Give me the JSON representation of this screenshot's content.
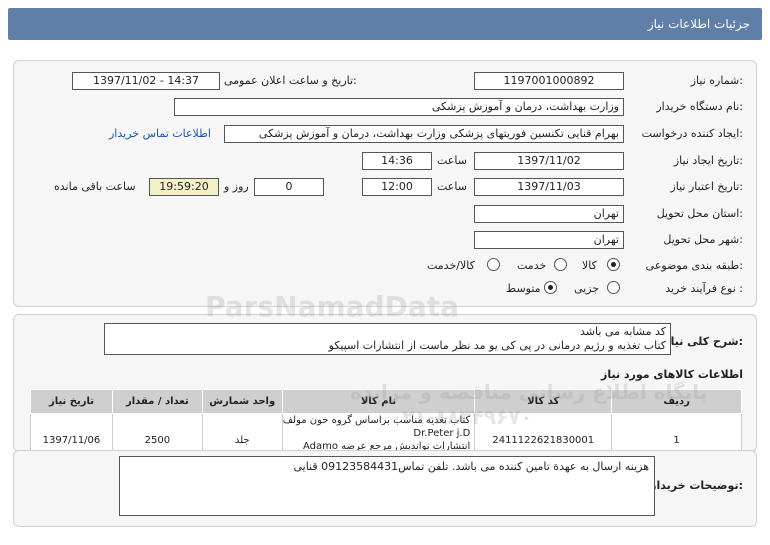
{
  "header": {
    "title": "جزئیات اطلاعات نیاز"
  },
  "form": {
    "need_number_label": "شماره نیاز:",
    "need_number": "1197001000892",
    "announce_label": "تاریخ و ساعت اعلان عمومی:",
    "announce_value": "1397/11/02 - 14:37",
    "buyer_label": "نام دستگاه خریدار:",
    "buyer_value": "وزارت بهداشت، درمان و آموزش پزشکی",
    "creator_label": "ایجاد کننده درخواست:",
    "creator_value": "بهرام قنایی تکنسین فوریتهای پزشکی وزارت بهداشت، درمان و آموزش پزشکی",
    "contact_link": "اطلاعات تماس خریدار",
    "created_date_label": "تاریخ ایجاد نیاز:",
    "created_date": "1397/11/02",
    "time_label": "ساعت",
    "created_time": "14:36",
    "valid_date_label": "تاریخ اعتبار نیاز:",
    "valid_date": "1397/11/03",
    "valid_time": "12:00",
    "days_value": "0",
    "days_label": "روز و",
    "remaining_time": "19:59:20",
    "remaining_label": "ساعت باقی مانده",
    "province_label": "استان محل تحویل:",
    "province_value": "تهران",
    "city_label": "شهر محل تحویل:",
    "city_value": "تهران",
    "category_label": "طبقه بندی موضوعی:",
    "category_options": [
      "کالا",
      "خدمت",
      "کالا/خدمت"
    ],
    "process_label": "نوع فرآیند خرید :",
    "process_options": [
      "جزیی",
      "متوسط"
    ]
  },
  "description": {
    "label": "شرح کلی نیاز:",
    "line1": "کد مشابه می باشد",
    "line2": "کتاب تغذیه و رژیم درمانی در پی کی یو مد نظر ماست از انتشارات اسپیکو"
  },
  "goods": {
    "title": "اطلاعات کالاهای مورد نیاز",
    "columns": [
      "ردیف",
      "کد کالا",
      "نام کالا",
      "واحد شمارش",
      "تعداد / مقدار",
      "تاریخ نیاز"
    ],
    "rows": [
      {
        "row": "1",
        "code": "2411122621830001",
        "name_line1": "کتاب تغذیه مناسب براساس گروه خون مولف Dr.Peter j.D",
        "name_line2": "Adamo انتشارات نواندیش مرجع عرضه کننده جام نور طلایی",
        "unit": "جلد",
        "qty": "2500",
        "date": "1397/11/06"
      }
    ]
  },
  "buyer_notes": {
    "label": "توضیحات خریدار:",
    "text": "هزینه ارسال به عهدة تامین کننده می باشد. تلفن تماس09123584431 قنایی"
  },
  "watermark": {
    "brand": "ParsNamadData",
    "line1": "پایگاه اطلاع رسانی مناقصه و مزایده",
    "line2": "۰۲۱-۸۸۳۴۹۶۷۰"
  }
}
